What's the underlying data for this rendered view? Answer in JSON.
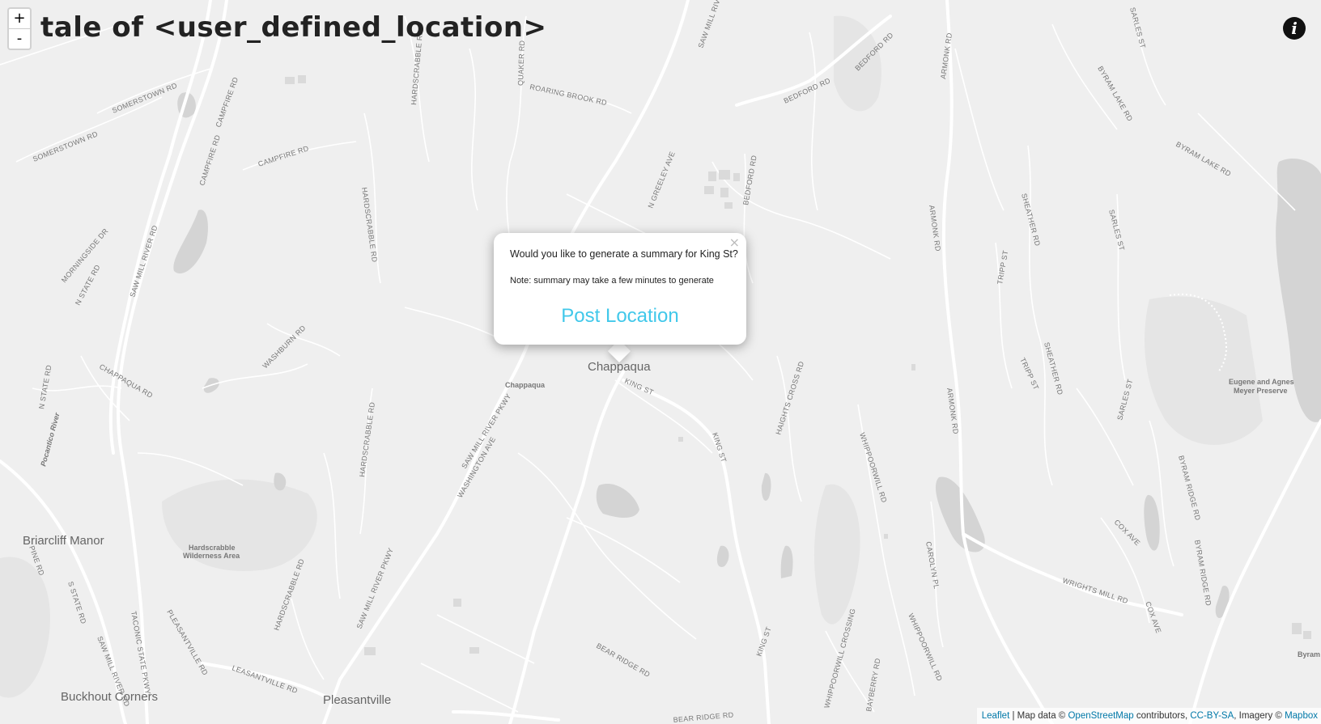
{
  "title": "tale of <user_defined_location>",
  "zoom": {
    "in": "+",
    "out": "-"
  },
  "info_icon": "i",
  "popup": {
    "close": "×",
    "question": "Would you like to generate a summary for King St?",
    "note": "Note: summary may take a few minutes to generate",
    "button": "Post Location"
  },
  "attribution": {
    "leaflet": "Leaflet",
    "text1": "| Map data ©",
    "osm": "OpenStreetMap",
    "text2": "contributors,",
    "license": "CC-BY-SA",
    "text3": ", Imagery ©",
    "mapbox": "Mapbox"
  },
  "places": {
    "chappaqua": "Chappaqua",
    "chappaqua_station": "Chappaqua",
    "briarcliff": "Briarcliff Manor",
    "pleasantville": "Pleasantville",
    "buckhout": "Buckhout Corners",
    "hardscrabble_wild1": "Hardscrabble",
    "hardscrabble_wild2": "Wilderness Area",
    "meyer1": "Eugene and Agnes",
    "meyer2": "Meyer Preserve",
    "byram_cut": "Byram",
    "pocantico": "Pocantico River"
  },
  "roads": {
    "somerstown1": "SOMERSTOWN RD",
    "somerstown2": "SOMERSTOWN RD",
    "campfire1": "CAMPFIRE RD",
    "campfire2": "CAMPFIRE RD",
    "campfire3": "CAMPFIRE RD",
    "saw_mill_river_rd1": "SAW MILL RIVER RD",
    "saw_mill_river_rd2": "SAW MILL RIVER RD",
    "saw_mill_river_rd3": "SAW MILL RIVER RD",
    "saw_mill_pkwy1": "SAW MILL RIVER PKWY",
    "saw_mill_pkwy2": "SAW MILL RIVER PKWY",
    "morningside": "MORNINGSIDE DR",
    "n_state1": "N STATE RD",
    "n_state2": "N STATE RD",
    "s_state": "S STATE RD",
    "chappaqua_rd": "CHAPPAQUA RD",
    "washburn": "WASHBURN RD",
    "hardscrabble1": "HARDSCRABBLE RD",
    "hardscrabble2": "HARDSCRABBLE RD",
    "hardscrabble3": "HARDSCRABBLE RD",
    "hardscrabble4": "HARDSCRABBLE RD",
    "quaker": "QUAKER RD",
    "roaring_brook": "ROARING BROOK RD",
    "n_greeley": "N GREELEY AVE",
    "bedford1": "BEDFORD RD",
    "bedford2": "BEDFORD RD",
    "bedford3": "BEDFORD RD",
    "armonk1": "ARMONK RD",
    "armonk2": "ARMONK RD",
    "armonk3": "ARMONK RD",
    "byram_lake1": "BYRAM LAKE RD",
    "byram_lake2": "BYRAM LAKE RD",
    "sheather1": "SHEATHER RD",
    "sheather2": "SHEATHER RD",
    "tripp1": "TRIPP ST",
    "tripp2": "TRIPP ST",
    "sarles1": "SARLES ST",
    "sarles2": "SARLES ST",
    "sarles3": "SARLES ST",
    "haights": "HAIGHTS CROSS RD",
    "king_st1": "KING ST",
    "king_st2": "KING ST",
    "king_st3": "KING ST",
    "whippoorwill1": "WHIPPOORWILL RD",
    "whippoorwill2": "WHIPPOORWILL RD",
    "whippoorwill_crossing": "WHIPPOORWILL CROSSING",
    "carolyn": "CAROLYN PL",
    "cox1": "COX AVE",
    "cox2": "COX AVE",
    "wrights_mill": "WRIGHTS MILL RD",
    "byram_ridge1": "BYRAM RIDGE RD",
    "byram_ridge2": "BYRAM RIDGE RD",
    "bear_ridge1": "BEAR RIDGE RD",
    "bear_ridge2": "BEAR RIDGE RD",
    "bayberry": "BAYBERRY RD",
    "washington": "WASHINGTON AVE",
    "pleasantville_rd": "PLEASANTVILLE RD",
    "leasantville_rd": "LEASANTVILLE RD",
    "taconic": "TACONIC STATE PKWY",
    "pine": "PINE RD"
  }
}
